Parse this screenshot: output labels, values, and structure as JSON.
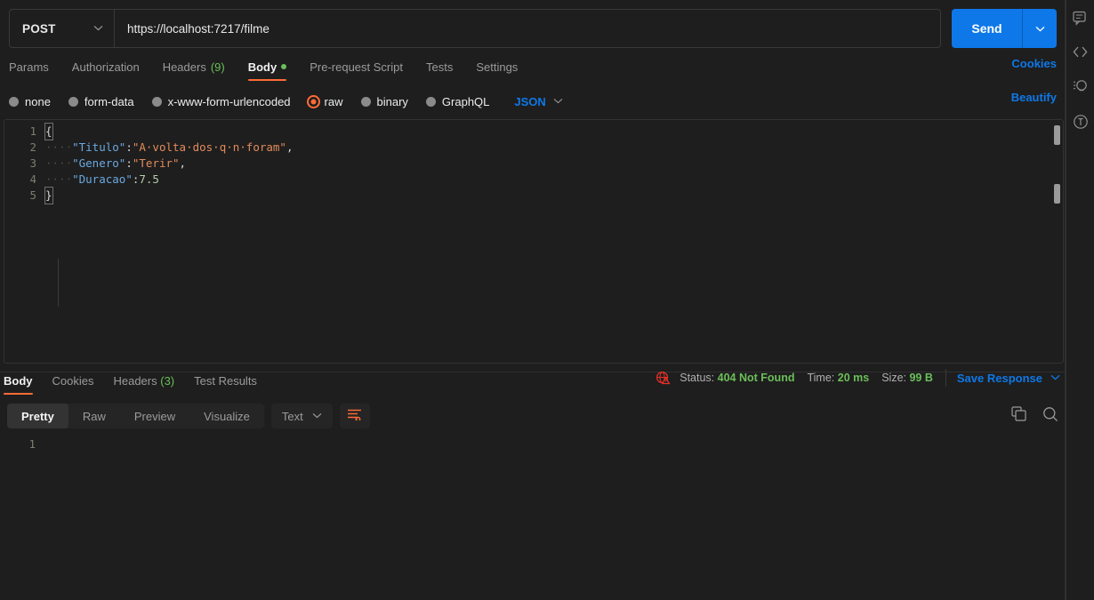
{
  "request": {
    "method": "POST",
    "method_icon": "chevron-down-icon",
    "url": "https://localhost:7217/filme",
    "send_label": "Send",
    "send_caret_icon": "chevron-down-icon",
    "tabs": [
      {
        "label": "Params",
        "active": false,
        "badge": "",
        "dot": false
      },
      {
        "label": "Authorization",
        "active": false,
        "badge": "",
        "dot": false
      },
      {
        "label": "Headers",
        "active": false,
        "badge": "(9)",
        "dot": false
      },
      {
        "label": "Body",
        "active": true,
        "badge": "",
        "dot": true
      },
      {
        "label": "Pre-request Script",
        "active": false,
        "badge": "",
        "dot": false
      },
      {
        "label": "Tests",
        "active": false,
        "badge": "",
        "dot": false
      },
      {
        "label": "Settings",
        "active": false,
        "badge": "",
        "dot": false
      }
    ],
    "cookies_link": "Cookies",
    "beautify_link": "Beautify",
    "body_types": [
      {
        "label": "none",
        "selected": false
      },
      {
        "label": "form-data",
        "selected": false
      },
      {
        "label": "x-www-form-urlencoded",
        "selected": false
      },
      {
        "label": "raw",
        "selected": true
      },
      {
        "label": "binary",
        "selected": false
      },
      {
        "label": "GraphQL",
        "selected": false
      }
    ],
    "raw_format": "JSON",
    "raw_format_icon": "chevron-down-icon",
    "editor_lines": [
      {
        "n": "1",
        "tokens": [
          {
            "t": "{",
            "c": "tok-p brace-box"
          }
        ]
      },
      {
        "n": "2",
        "tokens": [
          {
            "t": "····",
            "c": "tok-ws"
          },
          {
            "t": "\"Titulo\"",
            "c": "tok-key"
          },
          {
            "t": ":",
            "c": "tok-p"
          },
          {
            "t": "\"A·volta·dos·q·n·foram\"",
            "c": "tok-str"
          },
          {
            "t": ",",
            "c": "tok-p"
          }
        ]
      },
      {
        "n": "3",
        "tokens": [
          {
            "t": "····",
            "c": "tok-ws"
          },
          {
            "t": "\"Genero\"",
            "c": "tok-key"
          },
          {
            "t": ":",
            "c": "tok-p"
          },
          {
            "t": "\"Terir\"",
            "c": "tok-str"
          },
          {
            "t": ",",
            "c": "tok-p"
          }
        ]
      },
      {
        "n": "4",
        "tokens": [
          {
            "t": "····",
            "c": "tok-ws"
          },
          {
            "t": "\"Duracao\"",
            "c": "tok-key"
          },
          {
            "t": ":",
            "c": "tok-p"
          },
          {
            "t": "7.5",
            "c": "tok-num"
          }
        ]
      },
      {
        "n": "5",
        "tokens": [
          {
            "t": "}",
            "c": "tok-p brace-box"
          }
        ]
      }
    ]
  },
  "response": {
    "tabs": [
      {
        "label": "Body",
        "active": true,
        "badge": ""
      },
      {
        "label": "Cookies",
        "active": false,
        "badge": ""
      },
      {
        "label": "Headers",
        "active": false,
        "badge": "(3)"
      },
      {
        "label": "Test Results",
        "active": false,
        "badge": ""
      }
    ],
    "status_icon": "globe-warning-icon",
    "status_key": "Status:",
    "status_value": "404 Not Found",
    "time_key": "Time:",
    "time_value": "20 ms",
    "size_key": "Size:",
    "size_value": "99 B",
    "save_response": "Save Response",
    "save_response_icon": "chevron-down-icon",
    "view_modes": [
      {
        "label": "Pretty",
        "active": true
      },
      {
        "label": "Raw",
        "active": false
      },
      {
        "label": "Preview",
        "active": false
      },
      {
        "label": "Visualize",
        "active": false
      }
    ],
    "content_type": "Text",
    "content_type_icon": "chevron-down-icon",
    "wrap_icon": "wrap-lines-icon",
    "copy_icon": "copy-icon",
    "search_icon": "search-icon",
    "body_lines": [
      {
        "n": "1",
        "text": ""
      }
    ]
  },
  "right_rail": [
    {
      "icon": "comment-icon"
    },
    {
      "icon": "code-icon"
    },
    {
      "icon": "bulb-icon"
    },
    {
      "icon": "info-icon"
    }
  ],
  "colors": {
    "accent": "#ff6c37",
    "link": "#0e78e8",
    "success": "#6bbf59",
    "error": "#e8312b",
    "bg": "#1e1e1e"
  }
}
